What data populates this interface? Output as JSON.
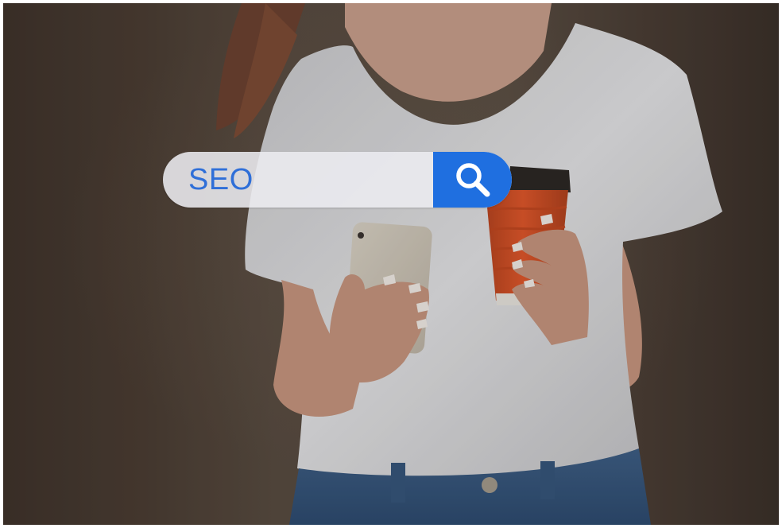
{
  "search": {
    "value": "SEO"
  },
  "icons": {
    "search_button_icon": "magnifier-icon"
  },
  "colors": {
    "accent": "#1f6fe0",
    "search_text": "#2f6fd8",
    "cup": "#e0562a"
  }
}
